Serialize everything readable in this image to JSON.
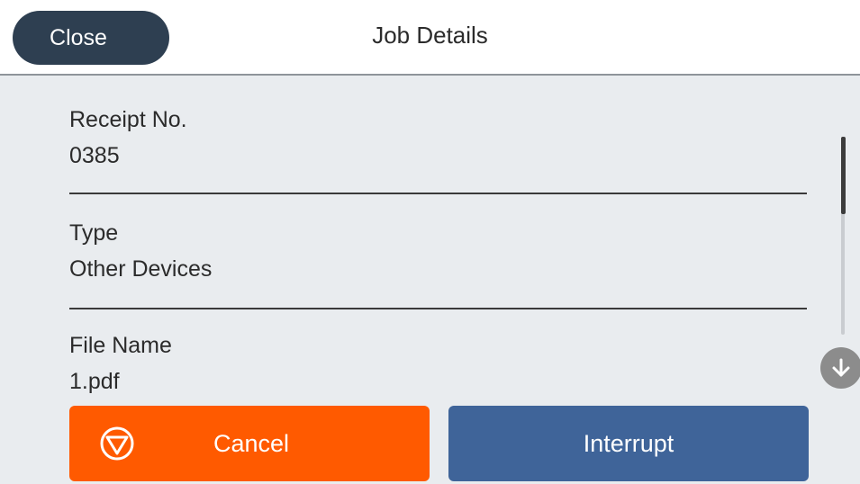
{
  "header": {
    "close_label": "Close",
    "title": "Job Details"
  },
  "details": [
    {
      "label": "Receipt No.",
      "value": "0385"
    },
    {
      "label": "Type",
      "value": "Other Devices"
    },
    {
      "label": "File Name",
      "value": "1.pdf"
    }
  ],
  "actions": {
    "cancel_label": "Cancel",
    "interrupt_label": "Interrupt"
  },
  "icons": {
    "cancel": "stop-triangle-icon",
    "scroll_down": "arrow-down-icon"
  },
  "colors": {
    "header_bg": "#ffffff",
    "close_button": "#2e3f51",
    "content_bg": "#e9ecef",
    "cancel_button": "#ff5a00",
    "interrupt_button": "#3f6499"
  }
}
